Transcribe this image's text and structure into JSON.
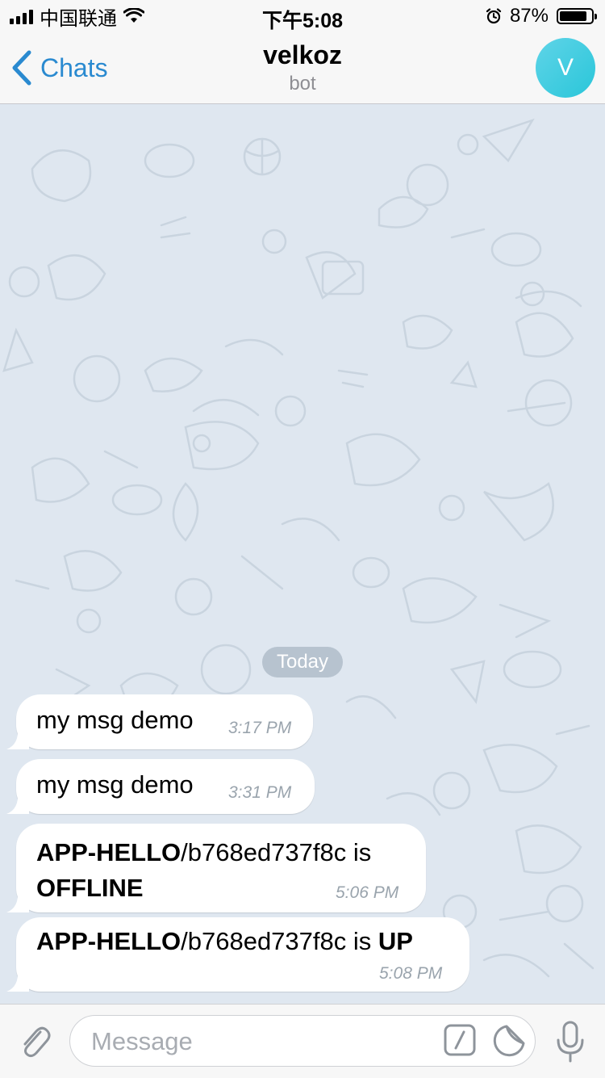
{
  "status_bar": {
    "carrier": "中国联通",
    "time": "下午5:08",
    "battery_percent": "87%",
    "battery_level": 0.87,
    "icons": [
      "signal-icon",
      "wifi-icon",
      "alarm-icon",
      "battery-icon"
    ]
  },
  "nav": {
    "back_label": "Chats",
    "title": "velkoz",
    "subtitle": "bot",
    "avatar_letter": "V",
    "accent_color": "#2a8ad0"
  },
  "chat": {
    "date_label": "Today",
    "messages": [
      {
        "text": "my msg demo",
        "time": "3:17 PM"
      },
      {
        "text": "my msg demo",
        "time": "3:31 PM"
      },
      {
        "bold1": "APP-HELLO",
        "mid": "/b768ed737f8c is",
        "bold2": "OFFLINE",
        "time": "5:06 PM"
      },
      {
        "bold1": "APP-HELLO",
        "mid": "/b768ed737f8c is ",
        "bold2": "UP",
        "time": "5:08 PM"
      }
    ]
  },
  "input": {
    "placeholder": "Message",
    "icons": [
      "paperclip-icon",
      "bot-command-icon",
      "sticker-icon",
      "microphone-icon"
    ]
  }
}
